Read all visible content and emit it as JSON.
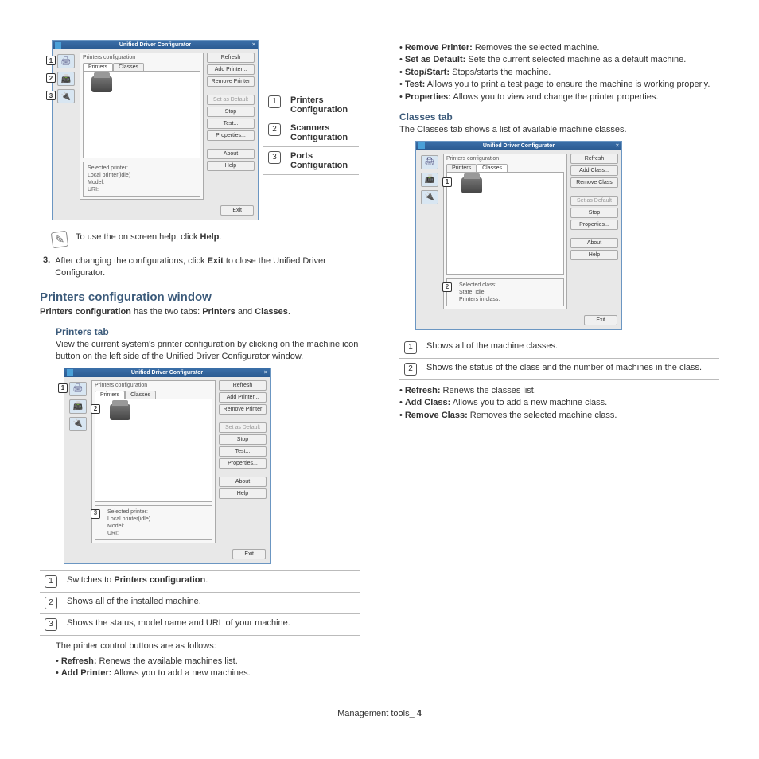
{
  "app": {
    "title": "Unified Driver Configurator",
    "groupLabel": "Printers configuration",
    "tabs": {
      "printers": "Printers",
      "classes": "Classes"
    },
    "buttons": {
      "refresh": "Refresh",
      "addPrinter": "Add Printer...",
      "removePrinter": "Remove Printer",
      "setDefault": "Set as Default",
      "stop": "Stop",
      "test": "Test...",
      "properties": "Properties...",
      "about": "About",
      "help": "Help",
      "exit": "Exit",
      "addClass": "Add Class...",
      "removeClass": "Remove Class"
    },
    "selectedPrinter": {
      "label": "Selected printer:",
      "line1": "Local printer(idle)",
      "line2": "Model:",
      "line3": "URI:"
    },
    "selectedClass": {
      "label": "Selected class:",
      "line1": "State: Idle",
      "line2": "Printers in class:"
    }
  },
  "sideLegend": {
    "r1n": "1",
    "r1a": "Printers",
    "r1b": "Configuration",
    "r2n": "2",
    "r2a": "Scanners",
    "r2b": "Configuration",
    "r3n": "3",
    "r3a": "Ports",
    "r3b": "Configuration"
  },
  "note": {
    "textA": "To use the on screen help, click ",
    "textB": "Help",
    "textC": "."
  },
  "step3": {
    "num": "3.",
    "a": "After changing the configurations, click ",
    "b": "Exit",
    "c": " to close the Unified Driver Configurator."
  },
  "sec1": {
    "title": "Printers configuration window",
    "p1a": "Printers configuration",
    "p1b": " has the two tabs: ",
    "p1c": "Printers",
    "p1d": " and ",
    "p1e": "Classes",
    "p1f": "."
  },
  "printersTab": {
    "title": "Printers tab",
    "p": "View the current system's printer configuration by clicking on the machine icon button on the left side of the Unified Driver Configurator window."
  },
  "legend1": {
    "r1n": "1",
    "r1a": "Switches to ",
    "r1b": "Printers configuration",
    "r1c": ".",
    "r2n": "2",
    "r2": "Shows all of the installed machine.",
    "r3n": "3",
    "r3": "Shows the status, model name and URL of your machine."
  },
  "controlIntro": "The printer control buttons are as follows:",
  "bulletsA": {
    "b1a": "Refresh:",
    "b1b": "  Renews the available machines list.",
    "b2a": "Add Printer:",
    "b2b": "  Allows you to add a new machines."
  },
  "bulletsB": {
    "b1a": "Remove Printer:",
    "b1b": "  Removes the selected machine.",
    "b2a": "Set as Default:",
    "b2b": "  Sets the current selected machine as a default machine.",
    "b3a": "Stop/Start:",
    "b3b": "  Stops/starts the machine.",
    "b4a": "Test:",
    "b4b": "  Allows you to print a test page to ensure the machine is working properly.",
    "b5a": "Properties:",
    "b5b": "  Allows you to view and change the printer properties."
  },
  "classesTab": {
    "title": "Classes tab",
    "p": "The Classes tab shows a list of available machine classes."
  },
  "legend2": {
    "r1n": "1",
    "r1": "Shows all of the machine classes.",
    "r2n": "2",
    "r2": "Shows the status of the class and the number of machines in the class."
  },
  "bulletsC": {
    "b1a": "Refresh:",
    "b1b": "  Renews the classes list.",
    "b2a": "Add Class:",
    "b2b": "  Allows you to add a new machine class.",
    "b3a": "Remove Class:",
    "b3b": "  Removes the selected machine class."
  },
  "footer": {
    "a": "Management tools_ ",
    "b": "4"
  }
}
